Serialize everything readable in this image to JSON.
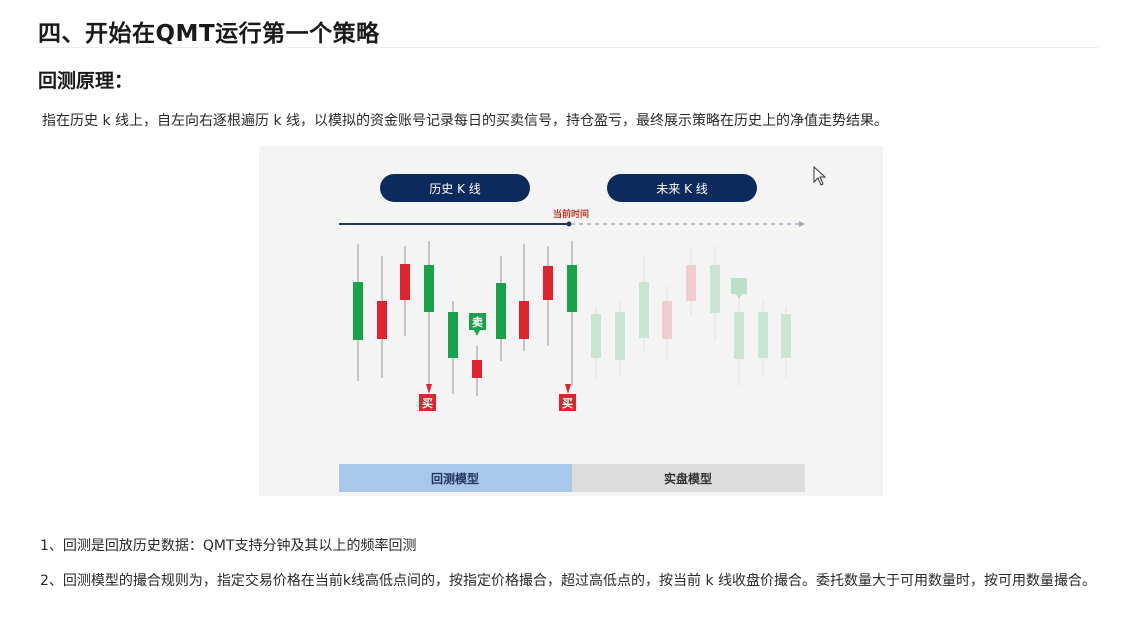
{
  "heading": "四、开始在QMT运行第一个策略",
  "subheading": "回测原理：",
  "intro": "指在历史 k 线上，自左向右逐根遍历 k 线，以模拟的资金账号记录每日的买卖信号，持仓盈亏，最终展示策略在历史上的净值走势结果。",
  "diagram": {
    "history_label": "历史 K 线",
    "future_label": "未来 K 线",
    "now_label": "当前时间",
    "buy_label": "买",
    "sell_label": "卖",
    "backtest_tab": "回测模型",
    "live_tab": "实盘模型",
    "colors": {
      "pill": "#0d2a5c",
      "up": "#e0242f",
      "down": "#16a34a",
      "backtest_tab": "#a9c7ea",
      "live_tab": "#dcdcdc"
    }
  },
  "point1": "1、回测是回放历史数据：QMT支持分钟及其以上的频率回测",
  "point2": "2、回测模型的撮合规则为，指定交易价格在当前k线高低点间的，按指定价格撮合，超过高低点的，按当前 k 线收盘价撮合。委托数量大于可用数量时，按可用数量撮合。"
}
